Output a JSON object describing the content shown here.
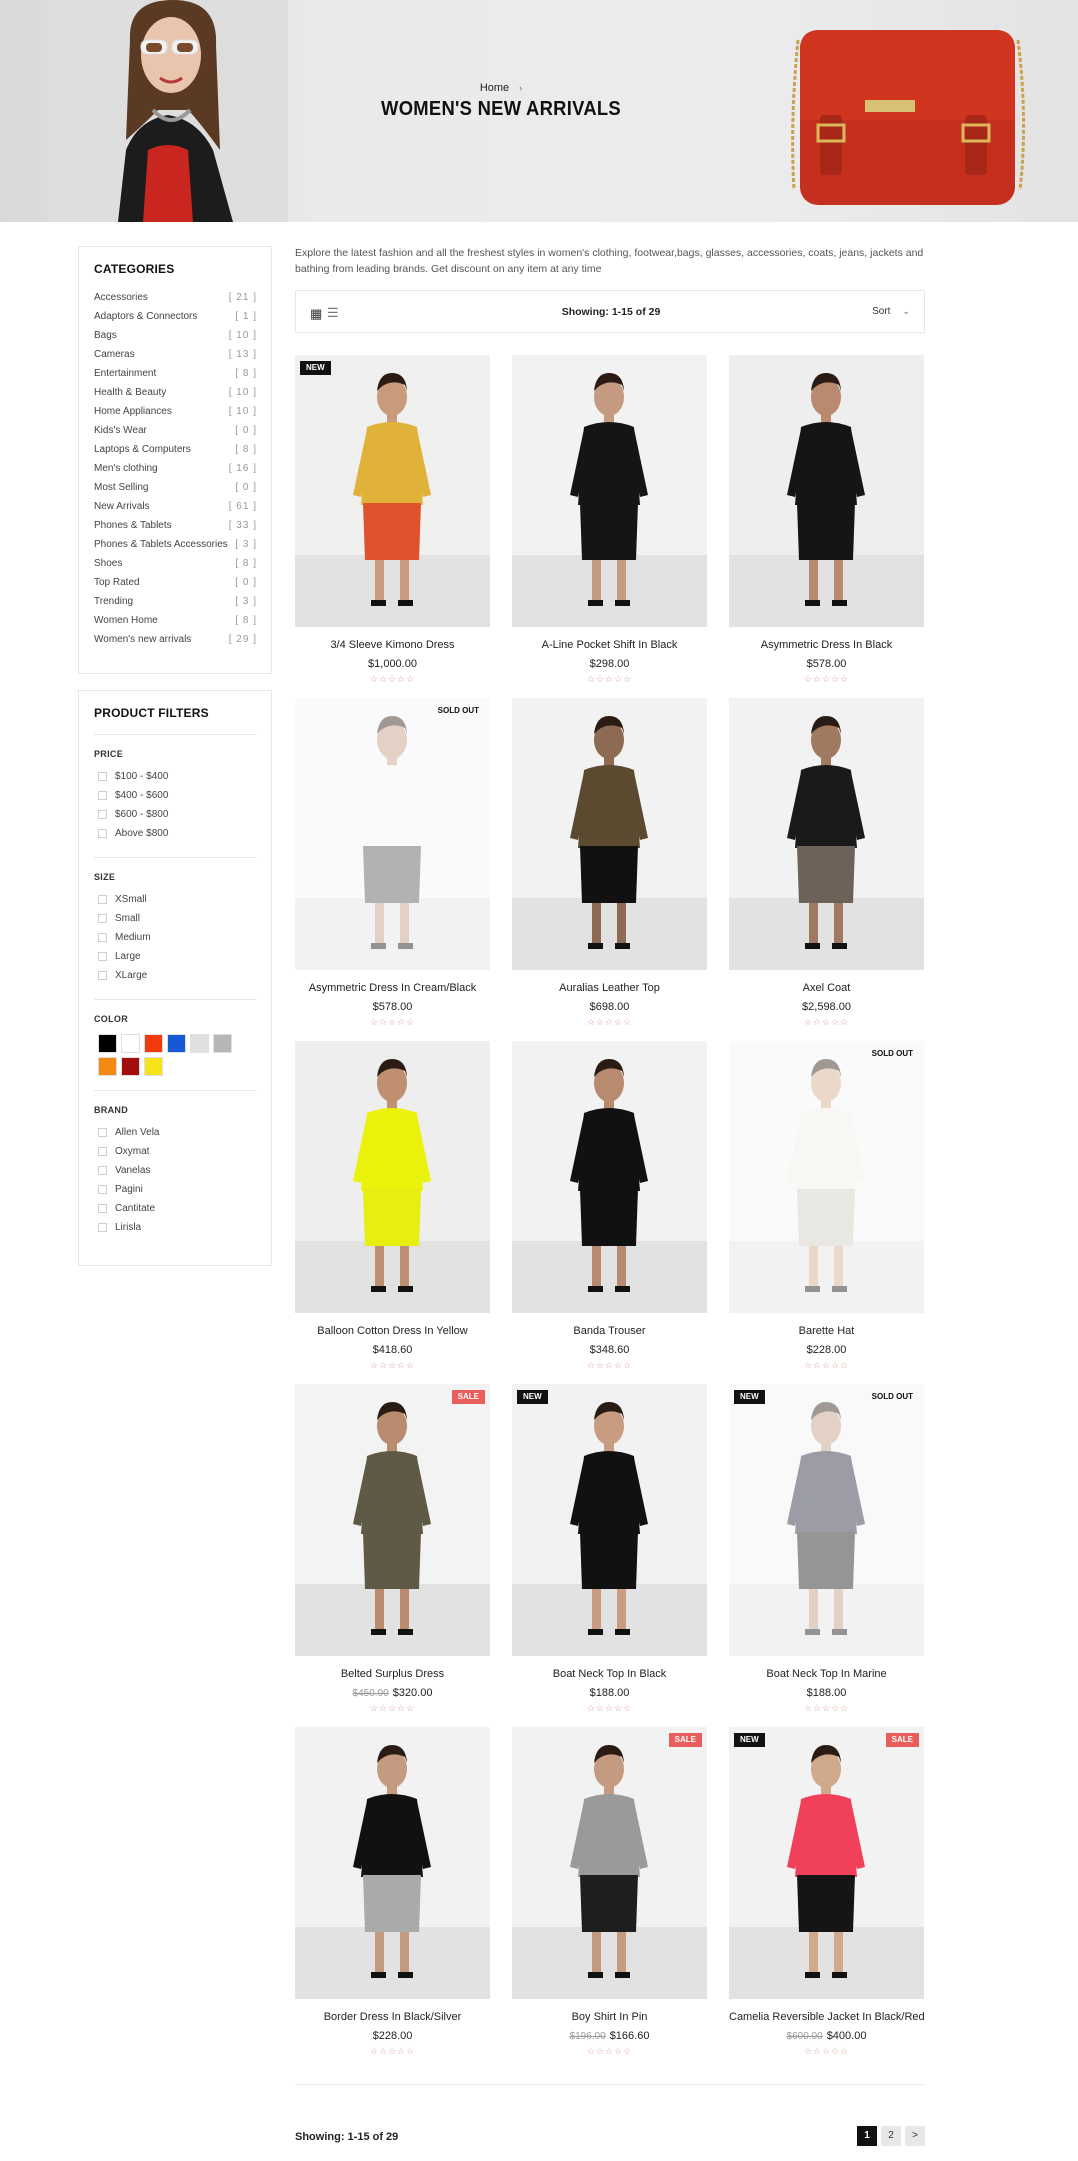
{
  "banner": {
    "breadcrumb_home": "Home",
    "breadcrumb_sep": "›",
    "title": "WOMEN'S NEW ARRIVALS"
  },
  "categories": {
    "title": "CATEGORIES",
    "items": [
      {
        "label": "Accessories",
        "count": "[ 21 ]"
      },
      {
        "label": "Adaptors & Connectors",
        "count": "[ 1 ]"
      },
      {
        "label": "Bags",
        "count": "[ 10 ]"
      },
      {
        "label": "Cameras",
        "count": "[ 13 ]"
      },
      {
        "label": "Entertainment",
        "count": "[ 8 ]"
      },
      {
        "label": "Health & Beauty",
        "count": "[ 10 ]"
      },
      {
        "label": "Home Appliances",
        "count": "[ 10 ]"
      },
      {
        "label": "Kids's Wear",
        "count": "[ 0 ]"
      },
      {
        "label": "Laptops & Computers",
        "count": "[ 8 ]"
      },
      {
        "label": "Men's clothing",
        "count": "[ 16 ]"
      },
      {
        "label": "Most Selling",
        "count": "[ 0 ]"
      },
      {
        "label": "New Arrivals",
        "count": "[ 61 ]"
      },
      {
        "label": "Phones & Tablets",
        "count": "[ 33 ]"
      },
      {
        "label": "Phones & Tablets Accessories",
        "count": "[ 3 ]"
      },
      {
        "label": "Shoes",
        "count": "[ 8 ]"
      },
      {
        "label": "Top Rated",
        "count": "[ 0 ]"
      },
      {
        "label": "Trending",
        "count": "[ 3 ]"
      },
      {
        "label": "Women Home",
        "count": "[ 8 ]"
      },
      {
        "label": "Women's new arrivals",
        "count": "[ 29 ]"
      }
    ]
  },
  "filters": {
    "title": "PRODUCT FILTERS",
    "price_heading": "PRICE",
    "price_options": [
      "$100 - $400",
      "$400 - $600",
      "$600 - $800",
      "Above $800"
    ],
    "size_heading": "SIZE",
    "size_options": [
      "XSmall",
      "Small",
      "Medium",
      "Large",
      "XLarge"
    ],
    "color_heading": "COLOR",
    "colors": [
      "#000000",
      "#ffffff",
      "#f13b0c",
      "#1658d6",
      "#e0e0e0",
      "#b6b6b6",
      "#f28a12",
      "#a40d0d",
      "#f7e31a"
    ],
    "brand_heading": "BRAND",
    "brand_options": [
      "Allen Vela",
      "Oxymat",
      "Vanelas",
      "Pagini",
      "Cantitate",
      "Lirisla"
    ]
  },
  "intro": "Explore the latest fashion and all the freshest styles in women's clothing, footwear,bags, glasses, accessories, coats, jeans, jackets and bathing from leading brands. Get discount on any item at any time",
  "toolbar": {
    "grid_icon": "grid-icon",
    "list_icon": "list-icon",
    "showing": "Showing: 1-15 of 29",
    "sort_label": "Sort",
    "sort_icon": "chevron-down-icon"
  },
  "products": [
    {
      "name": "3/4 Sleeve Kimono Dress",
      "price": "$1,000.00",
      "old_price": "",
      "badge_left": "NEW",
      "badge_right": "",
      "sold_out": false,
      "stars": "☆☆☆☆☆"
    },
    {
      "name": "A-Line Pocket Shift In Black",
      "price": "$298.00",
      "old_price": "",
      "badge_left": "",
      "badge_right": "",
      "sold_out": false,
      "stars": "☆☆☆☆☆"
    },
    {
      "name": "Asymmetric Dress In Black",
      "price": "$578.00",
      "old_price": "",
      "badge_left": "",
      "badge_right": "",
      "sold_out": false,
      "stars": "☆☆☆☆☆"
    },
    {
      "name": "Asymmetric Dress In Cream/Black",
      "price": "$578.00",
      "old_price": "",
      "badge_left": "",
      "badge_right": "SOLD OUT",
      "sold_out": true,
      "stars": "☆☆☆☆☆"
    },
    {
      "name": "Auralias Leather Top",
      "price": "$698.00",
      "old_price": "",
      "badge_left": "",
      "badge_right": "",
      "sold_out": false,
      "stars": "☆☆☆☆☆"
    },
    {
      "name": "Axel Coat",
      "price": "$2,598.00",
      "old_price": "",
      "badge_left": "",
      "badge_right": "",
      "sold_out": false,
      "stars": "☆☆☆☆☆"
    },
    {
      "name": "Balloon Cotton Dress In Yellow",
      "price": "$418.60",
      "old_price": "",
      "badge_left": "",
      "badge_right": "",
      "sold_out": false,
      "stars": "☆☆☆☆☆"
    },
    {
      "name": "Banda Trouser",
      "price": "$348.60",
      "old_price": "",
      "badge_left": "",
      "badge_right": "",
      "sold_out": false,
      "stars": "☆☆☆☆☆"
    },
    {
      "name": "Barette Hat",
      "price": "$228.00",
      "old_price": "",
      "badge_left": "",
      "badge_right": "SOLD OUT",
      "sold_out": true,
      "stars": "☆☆☆☆☆"
    },
    {
      "name": "Belted Surplus Dress",
      "price": "$320.00",
      "old_price": "$450.00",
      "badge_left": "",
      "badge_right": "SALE",
      "sold_out": false,
      "stars": "☆☆☆☆☆"
    },
    {
      "name": "Boat Neck Top In Black",
      "price": "$188.00",
      "old_price": "",
      "badge_left": "NEW",
      "badge_right": "",
      "sold_out": false,
      "stars": "☆☆☆☆☆"
    },
    {
      "name": "Boat Neck Top In Marine",
      "price": "$188.00",
      "old_price": "",
      "badge_left": "NEW",
      "badge_right": "SOLD OUT",
      "sold_out": true,
      "stars": "☆☆☆☆☆"
    },
    {
      "name": "Border Dress In Black/Silver",
      "price": "$228.00",
      "old_price": "",
      "badge_left": "",
      "badge_right": "",
      "sold_out": false,
      "stars": "☆☆☆☆☆"
    },
    {
      "name": "Boy Shirt In Pin",
      "price": "$166.60",
      "old_price": "$196.00",
      "badge_left": "",
      "badge_right": "SALE",
      "sold_out": false,
      "stars": "☆☆☆☆☆"
    },
    {
      "name": "Camelia Reversible Jacket In Black/Red",
      "price": "$400.00",
      "old_price": "$600.00",
      "badge_left": "NEW",
      "badge_right": "SALE",
      "sold_out": false,
      "stars": "☆☆☆☆☆"
    }
  ],
  "footer": {
    "showing": "Showing: 1-15 of 29",
    "pages": [
      "1",
      "2",
      ">"
    ]
  }
}
